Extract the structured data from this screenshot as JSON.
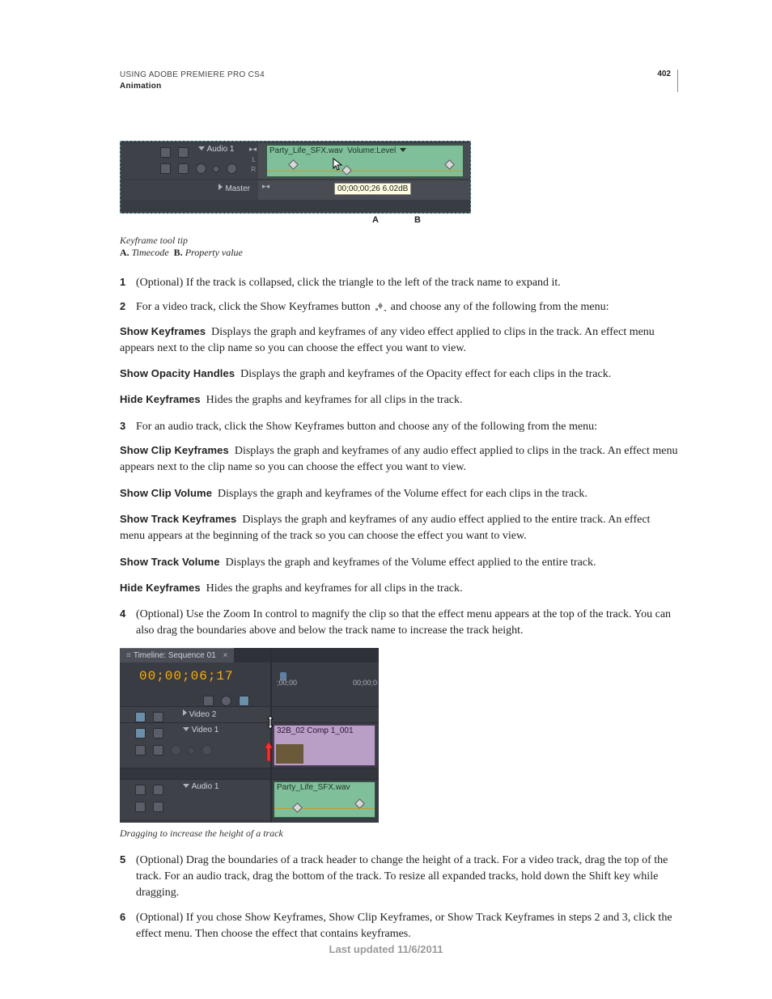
{
  "header": {
    "title": "USING ADOBE PREMIERE PRO CS4",
    "section": "Animation",
    "page_number": "402"
  },
  "figure1": {
    "track_audio_label": "Audio 1",
    "track_master_label": "Master",
    "clip_label": "Party_Life_SFX.wav",
    "clip_effect": "Volume:Level",
    "tooltip_timecode": "00;00;00;26",
    "tooltip_value": "6.02dB",
    "marker_a": "A",
    "marker_b": "B",
    "caption_title": "Keyframe tool tip",
    "caption_a_key": "A.",
    "caption_a_val": "Timecode",
    "caption_b_key": "B.",
    "caption_b_val": "Property value"
  },
  "figure2": {
    "panel_title": "Timeline: Sequence 01",
    "timecode": "00;00;06;17",
    "ruler_a": ";00;00",
    "ruler_b": "00;00;0",
    "track_video2": "Video 2",
    "track_video1": "Video 1",
    "track_audio1": "Audio 1",
    "clip_video": "32B_02 Comp 1_001",
    "clip_audio": "Party_Life_SFX.wav",
    "caption": "Dragging to increase the height of a track"
  },
  "steps": {
    "s1": {
      "num": "1",
      "text": "(Optional) If the track is collapsed, click the triangle to the left of the track name to expand it."
    },
    "s2": {
      "num": "2",
      "text_a": "For a video track, click the Show Keyframes button",
      "text_b": "and choose any of the following from the menu:"
    },
    "s3": {
      "num": "3",
      "text": "For an audio track, click the Show Keyframes button and choose any of the following from the menu:"
    },
    "s4": {
      "num": "4",
      "text": "(Optional) Use the Zoom In control to magnify the clip so that the effect menu appears at the top of the track. You can also drag the boundaries above and below the track name to increase the track height."
    },
    "s5": {
      "num": "5",
      "text": "(Optional) Drag the boundaries of a track header to change the height of a track. For a video track, drag the top of the track. For an audio track, drag the bottom of the track. To resize all expanded tracks, hold down the Shift key while dragging."
    },
    "s6": {
      "num": "6",
      "text": "(Optional) If you chose Show Keyframes, Show Clip Keyframes, or Show Track Keyframes in steps 2 and 3, click the effect menu. Then choose the effect that contains keyframes."
    }
  },
  "defs": {
    "show_keyframes": {
      "term": "Show Keyframes",
      "desc": "Displays the graph and keyframes of any video effect applied to clips in the track. An effect menu appears next to the clip name so you can choose the effect you want to view."
    },
    "show_opacity": {
      "term": "Show Opacity Handles",
      "desc": "Displays the graph and keyframes of the Opacity effect for each clips in the track."
    },
    "hide_keyframes1": {
      "term": "Hide Keyframes",
      "desc": "Hides the graphs and keyframes for all clips in the track."
    },
    "show_clip_kf": {
      "term": "Show Clip Keyframes",
      "desc": "Displays the graph and keyframes of any audio effect applied to clips in the track. An effect menu appears next to the clip name so you can choose the effect you want to view."
    },
    "show_clip_vol": {
      "term": "Show Clip Volume",
      "desc": "Displays the graph and keyframes of the Volume effect for each clips in the track."
    },
    "show_track_kf": {
      "term": "Show Track Keyframes",
      "desc": "Displays the graph and keyframes of any audio effect applied to the entire track. An effect menu appears at the beginning of the track so you can choose the effect you want to view."
    },
    "show_track_vol": {
      "term": "Show Track Volume",
      "desc": "Displays the graph and keyframes of the Volume effect applied to the entire track."
    },
    "hide_keyframes2": {
      "term": "Hide Keyframes",
      "desc": "Hides the graphs and keyframes for all clips in the track."
    }
  },
  "footer": {
    "text": "Last updated 11/6/2011"
  }
}
